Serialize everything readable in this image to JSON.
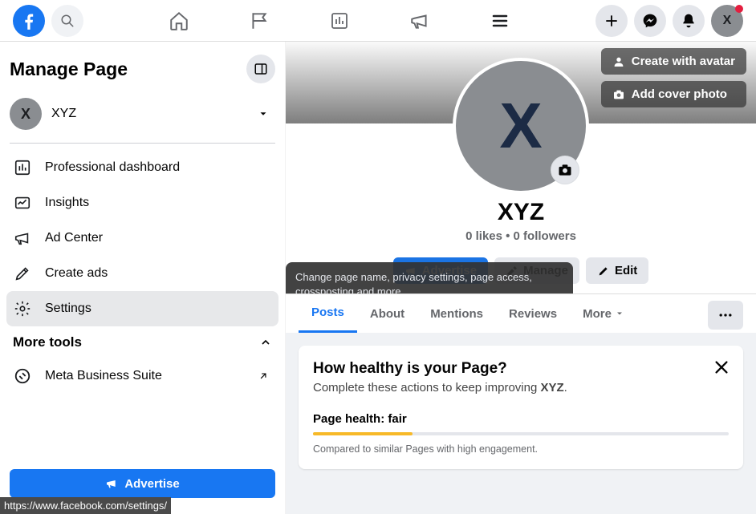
{
  "topnav": {
    "avatar_letter": "X"
  },
  "sidebar": {
    "title": "Manage Page",
    "page_avatar_letter": "X",
    "page_name": "XYZ",
    "items": [
      {
        "label": "Professional dashboard"
      },
      {
        "label": "Insights"
      },
      {
        "label": "Ad Center"
      },
      {
        "label": "Create ads"
      },
      {
        "label": "Settings"
      }
    ],
    "section_label": "More tools",
    "meta_suite": "Meta Business Suite",
    "advertise_btn": "Advertise"
  },
  "cover": {
    "create_avatar": "Create with avatar",
    "add_cover": "Add cover photo"
  },
  "profile": {
    "avatar_letter": "X",
    "name": "XYZ",
    "stats": "0 likes • 0 followers"
  },
  "actions": {
    "advertise": "Advertise",
    "manage": "Manage",
    "edit": "Edit",
    "tooltip": "Change page name, privacy settings, page access, crossposting and more."
  },
  "tabs": {
    "posts": "Posts",
    "about": "About",
    "mentions": "Mentions",
    "reviews": "Reviews",
    "more": "More"
  },
  "health_card": {
    "title": "How healthy is your Page?",
    "subtitle_prefix": "Complete these actions to keep improving ",
    "subtitle_bold": "XYZ",
    "subtitle_suffix": ".",
    "health_label": "Page health: fair",
    "health_pct": 24,
    "note": "Compared to similar Pages with high engagement."
  },
  "status_url": "https://www.facebook.com/settings/"
}
